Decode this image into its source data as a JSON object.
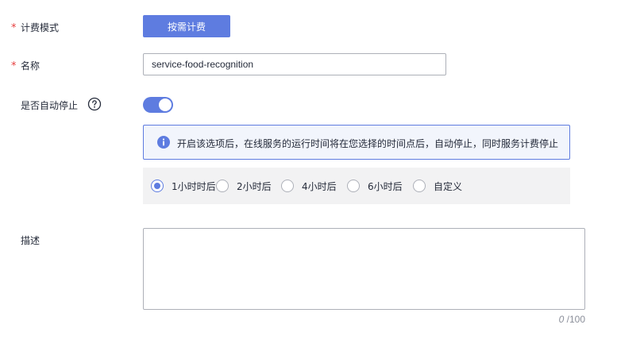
{
  "form": {
    "billing_mode": {
      "label": "计费模式",
      "required_mark": "*",
      "button_label": "按需计费"
    },
    "name": {
      "label": "名称",
      "required_mark": "*",
      "value": "service-food-recognition"
    },
    "auto_stop": {
      "label": "是否自动停止",
      "help_icon": "question-circle-icon",
      "enabled": true,
      "info_icon": "info-icon",
      "info_text": "开启该选项后，在线服务的运行时间将在您选择的时间点后，自动停止，同时服务计费停止",
      "options": [
        "1小时时后",
        "2小时后",
        "4小时后",
        "6小时后",
        "自定义"
      ],
      "selected_index": 0
    },
    "description": {
      "label": "描述",
      "value": "",
      "count_current": "0",
      "count_max": "/100"
    }
  },
  "colors": {
    "primary": "#5e7ce0",
    "required": "#e63f3f",
    "text": "#252b3a",
    "muted": "#8a8e99",
    "border": "#adb0b8",
    "panel_bg": "#f2f2f3",
    "info_bg": "#f2f5fc"
  }
}
